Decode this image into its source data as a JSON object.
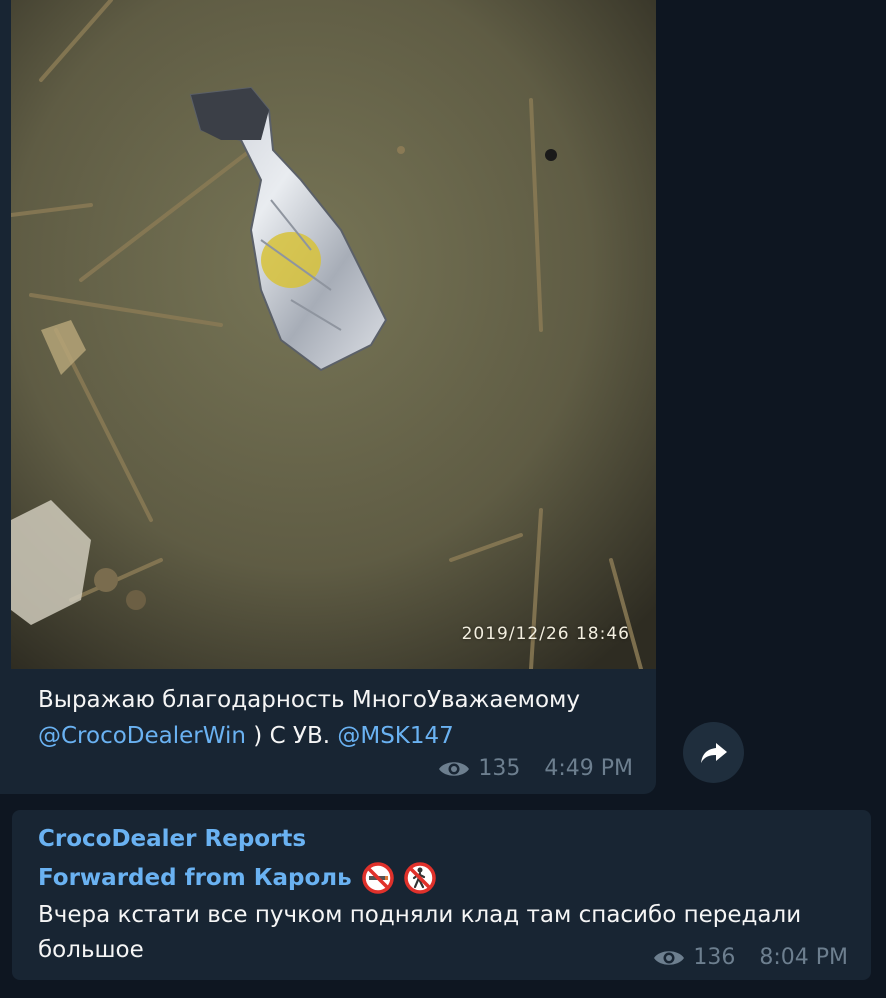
{
  "message1": {
    "photo_timestamp": "2019/12/26  18:46",
    "caption_line1": "Выражаю благодарность МногоУважаемому",
    "mention1": "@CrocoDealerWin",
    "caption_mid": " ) С УВ. ",
    "mention2": "@MSK147",
    "views": "135",
    "time": "4:49 PM"
  },
  "message2": {
    "sender": "CrocoDealer Reports",
    "forwarded_label": "Forwarded from Кароль",
    "text": "Вчера кстати все пучком подняли клад там спасибо передали большое",
    "views": "136",
    "time": "8:04 PM"
  },
  "icons": {
    "share": "share-arrow-icon",
    "views": "eye-icon",
    "emoji1": "no-smoking-emoji",
    "emoji2": "no-pedestrians-emoji"
  },
  "colors": {
    "background": "#0e1621",
    "bubble": "#182533",
    "link": "#6ab2f2",
    "meta": "#6d7f8f"
  }
}
